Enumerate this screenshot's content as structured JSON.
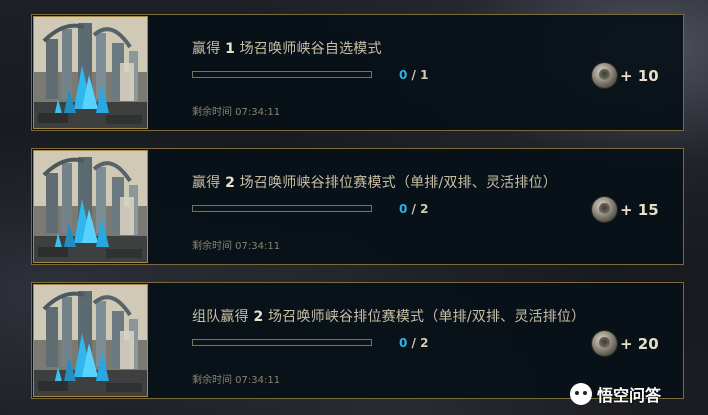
{
  "missions": [
    {
      "title_prefix": "赢得 ",
      "title_count": "1",
      "title_suffix": " 场召唤师峡谷自选模式",
      "progress_current": "0",
      "progress_total": "/ 1",
      "progress_fraction": 0,
      "reward_text": "+ 10",
      "time_remaining": "剩余时间 07:34:11"
    },
    {
      "title_prefix": "赢得 ",
      "title_count": "2",
      "title_suffix": " 场召唤师峡谷排位赛模式（单排/双排、灵活排位）",
      "progress_current": "0",
      "progress_total": "/ 2",
      "progress_fraction": 0,
      "reward_text": "+ 15",
      "time_remaining": "剩余时间 07:34:11"
    },
    {
      "title_prefix": "组队赢得 ",
      "title_count": "2",
      "title_suffix": " 场召唤师峡谷排位赛模式（单排/双排、灵活排位）",
      "progress_current": "0",
      "progress_total": "/ 2",
      "progress_fraction": 0,
      "reward_text": "+ 20",
      "time_remaining": "剩余时间 07:34:11"
    }
  ],
  "watermark": {
    "text": "悟空问答",
    "icon": "wukong-logo-icon"
  },
  "colors": {
    "card_border": "#7a6a3e",
    "thumb_border": "#a48a4a",
    "progress_current": "#2bb3e6",
    "title_text": "#c8bfa6"
  }
}
